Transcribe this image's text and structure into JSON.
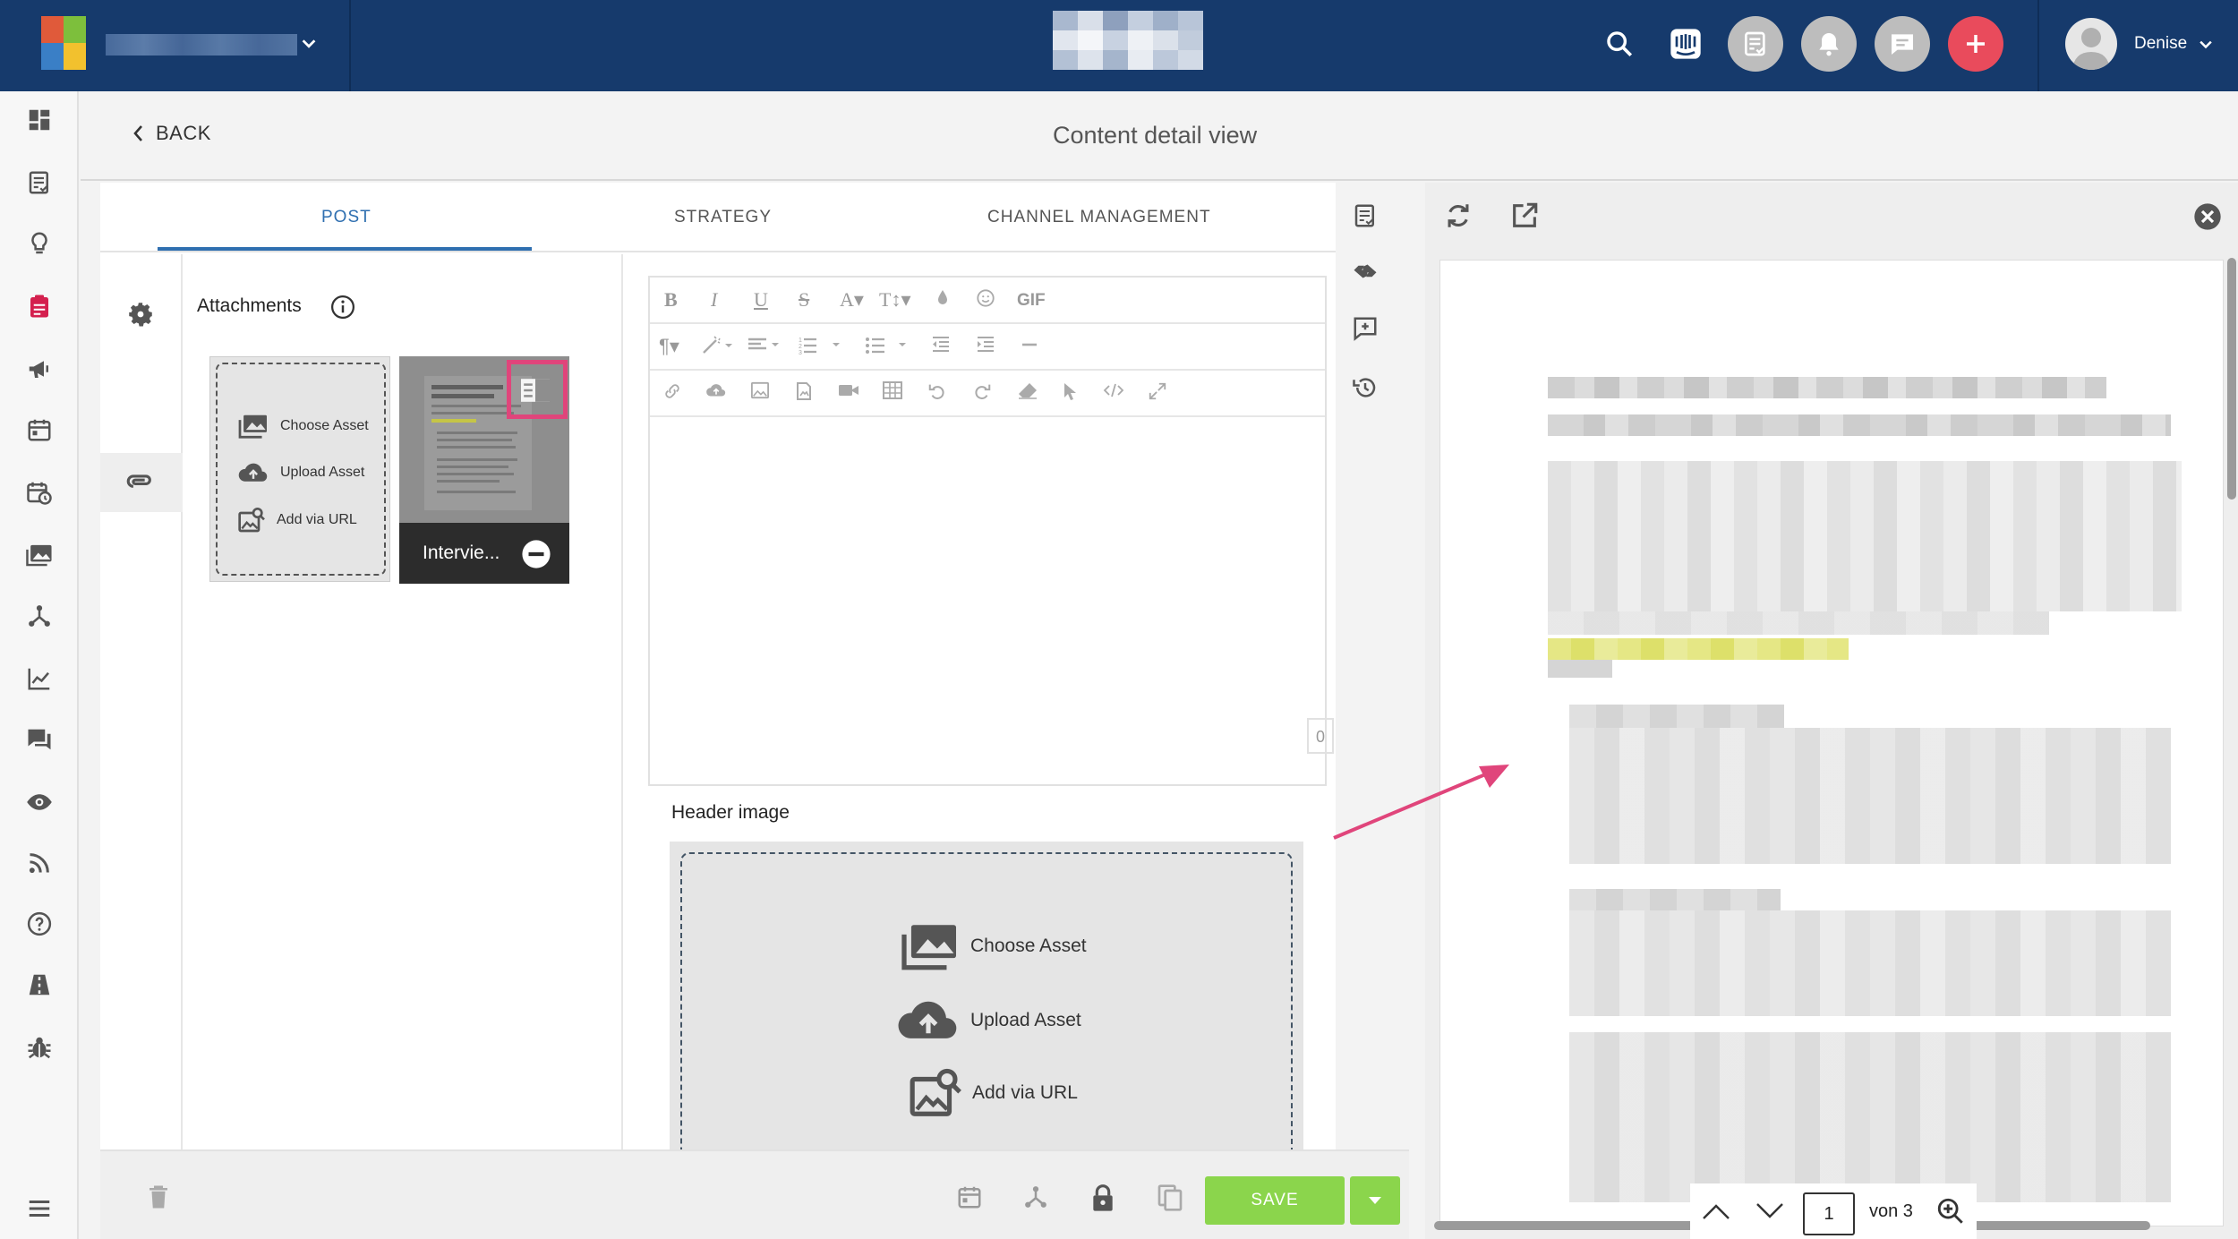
{
  "header": {
    "user_name": "Denise"
  },
  "page": {
    "back_label": "BACK",
    "title": "Content detail view"
  },
  "tabs": [
    {
      "label": "POST",
      "active": true
    },
    {
      "label": "STRATEGY",
      "active": false
    },
    {
      "label": "CHANNEL MANAGEMENT",
      "active": false
    }
  ],
  "attachments": {
    "title": "Attachments",
    "actions": [
      "Choose Asset",
      "Upload Asset",
      "Add via URL"
    ],
    "items": [
      {
        "name": "Intervie..."
      }
    ]
  },
  "editor": {
    "gif_label": "GIF",
    "char_count": "0"
  },
  "header_image": {
    "label": "Header image",
    "actions": [
      "Choose Asset",
      "Upload Asset",
      "Add via URL"
    ]
  },
  "toolbar": {
    "save_label": "SAVE"
  },
  "preview": {
    "page_number": "1",
    "page_of": "von 3"
  },
  "colors": {
    "topbar": "#163a6c",
    "accent_blue": "#2f6fb0",
    "save_green": "#8bd54c",
    "highlight_pink": "#e0457b",
    "add_red": "#e94b5c"
  }
}
